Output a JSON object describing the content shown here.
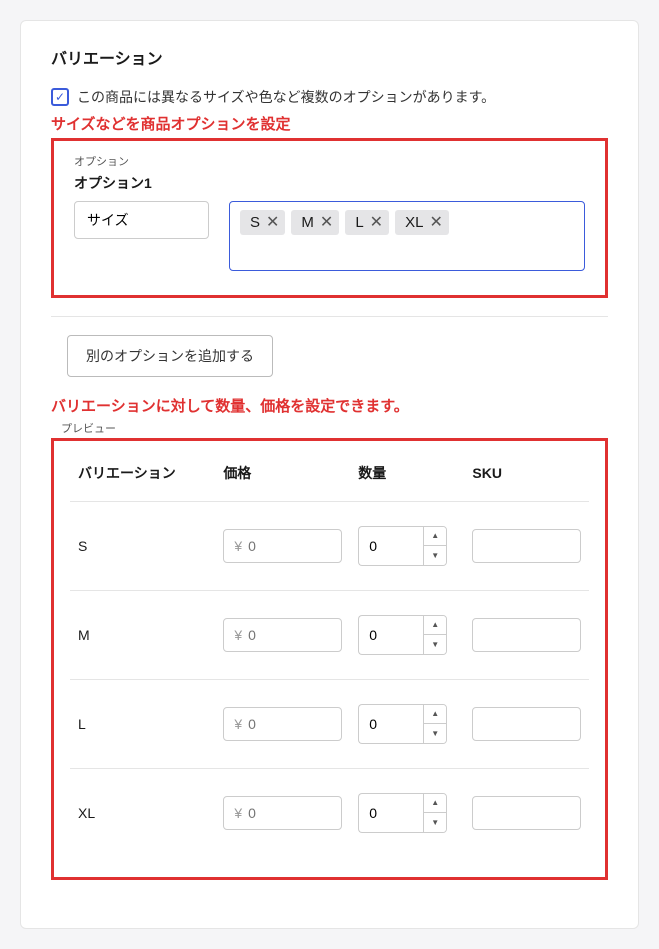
{
  "section": {
    "title": "バリエーション",
    "checkbox_label": "この商品には異なるサイズや色など複数のオプションがあります。",
    "checkbox_checked": true
  },
  "annotations": {
    "options": "サイズなどを商品オプションを設定",
    "preview": "バリエーションに対して数量、価格を設定できます。"
  },
  "options": {
    "box_label": "オプション",
    "option1_label": "オプション1",
    "name_value": "サイズ",
    "tags": [
      "S",
      "M",
      "L",
      "XL"
    ],
    "add_button": "別のオプションを追加する"
  },
  "preview": {
    "label": "プレビュー",
    "columns": {
      "variation": "バリエーション",
      "price": "価格",
      "qty": "数量",
      "sku": "SKU"
    },
    "currency_symbol": "¥",
    "price_placeholder": "0",
    "rows": [
      {
        "variation": "S",
        "price": "",
        "qty": "0",
        "sku": ""
      },
      {
        "variation": "M",
        "price": "",
        "qty": "0",
        "sku": ""
      },
      {
        "variation": "L",
        "price": "",
        "qty": "0",
        "sku": ""
      },
      {
        "variation": "XL",
        "price": "",
        "qty": "0",
        "sku": ""
      }
    ]
  }
}
